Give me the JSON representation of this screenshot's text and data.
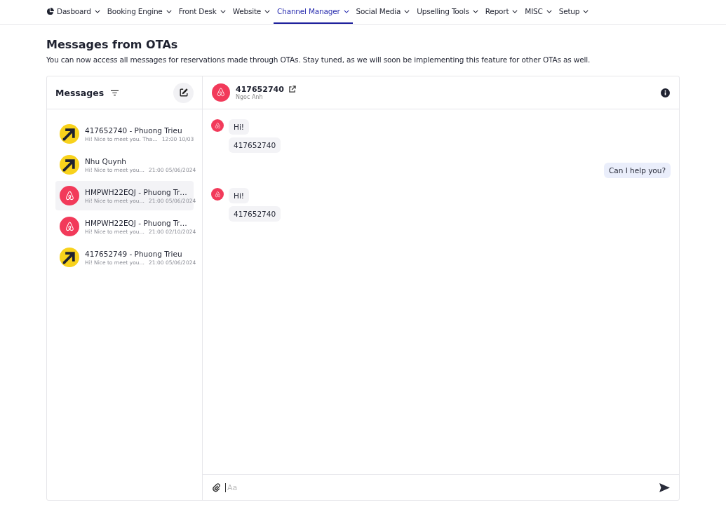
{
  "nav": [
    {
      "label": "Dasboard",
      "selected": false
    },
    {
      "label": "Booking Engine",
      "selected": false
    },
    {
      "label": "Front Desk",
      "selected": false
    },
    {
      "label": "Website",
      "selected": false
    },
    {
      "label": "Channel Manager",
      "selected": true
    },
    {
      "label": "Social Media",
      "selected": false
    },
    {
      "label": "Upselling Tools",
      "selected": false
    },
    {
      "label": "Report",
      "selected": false
    },
    {
      "label": "MISC",
      "selected": false
    },
    {
      "label": "Setup",
      "selected": false
    }
  ],
  "page": {
    "title": "Messages from OTAs",
    "description": "You can now access all messages for reservations made through OTAs. Stay tuned, as we will soon be implementing this feature for other OTAs as well."
  },
  "conversations_title": "Messages",
  "conversations": [
    {
      "kind": "arrow",
      "name": "417652740 - Phuong Trieu",
      "preview": "Hi! Nice to meet you. Tha…",
      "time": "12:00 10/03",
      "selected": false
    },
    {
      "kind": "arrow",
      "name": "Nhu Quynh",
      "preview": "Hi! Nice to meet you…",
      "time": "21:00 05/06/2024",
      "selected": false
    },
    {
      "kind": "bnb",
      "name": "HMPWH22EQJ - Phuong Tr…",
      "preview": "Hi! Nice to meet you…",
      "time": "21:00 05/06/2024",
      "selected": true
    },
    {
      "kind": "bnb",
      "name": "HMPWH22EQJ - Phuong Tr…",
      "preview": "Hi! Nice to meet you…",
      "time": "21:00 02/10/2024",
      "selected": false
    },
    {
      "kind": "arrow",
      "name": "417652749 - Phuong Trieu",
      "preview": "Hi! Nice to meet you…",
      "time": "21:00 05/06/2024",
      "selected": false
    }
  ],
  "chat": {
    "title": "417652740",
    "subtitle": "Ngoc Anh",
    "groups": [
      {
        "kind": "incoming",
        "messages": [
          "Hi!",
          "417652740"
        ]
      },
      {
        "kind": "outgoing",
        "messages": [
          "Can I help you?"
        ]
      },
      {
        "kind": "incoming",
        "messages": [
          "Hi!",
          "417652740"
        ]
      }
    ],
    "composer": {
      "placeholder": "Aa"
    }
  }
}
